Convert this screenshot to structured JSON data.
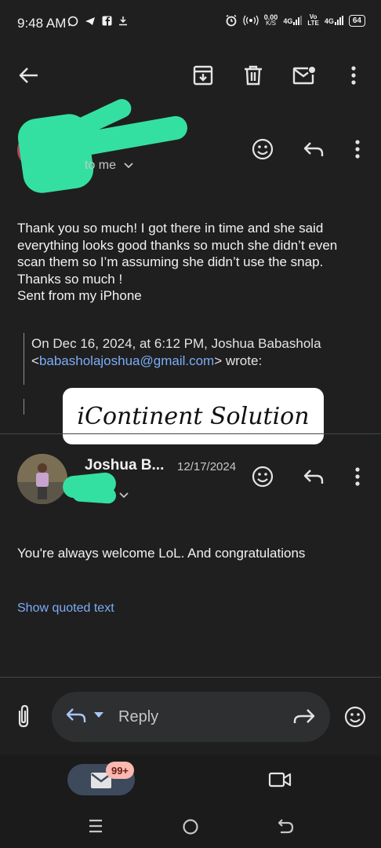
{
  "status_bar": {
    "time": "9:48 AM",
    "net_speed_value": "0.00",
    "net_speed_unit": "K/S",
    "network_1": "4G",
    "network_2_top": "Vo",
    "network_2_bottom": "LTE",
    "network_3": "4G",
    "battery": "64"
  },
  "toolbar": {
    "back_icon": "arrow-left-icon",
    "archive_icon": "archive-icon",
    "delete_icon": "trash-icon",
    "mark_unread_icon": "mail-unread-icon",
    "more_icon": "more-vertical-icon"
  },
  "message_1": {
    "to": "to me",
    "body_lines": [
      "Thank you so much! I got there in time and she said",
      "everything looks good thanks so much she didn’t even",
      "scan them so I’m assuming she didn’t use the snap.",
      "Thanks so much !",
      "Sent from my iPhone"
    ],
    "quote_line1": "On Dec 16, 2024, at 6:12 PM, Joshua Babashola",
    "quote_lt": "<",
    "quote_email": "babasholajoshua@gmail.com",
    "quote_gt_wrote": "> wrote:"
  },
  "watermark": "iContinent Solution",
  "message_2": {
    "sender": "Joshua B...",
    "date": "12/17/2024",
    "body": "You're always welcome LoL. And congratulations",
    "show_quoted": "Show quoted text"
  },
  "reply_bar": {
    "reply_label": "Reply"
  },
  "bottom_nav": {
    "mail_badge": "99+"
  },
  "colors": {
    "background": "#1f1f1f",
    "link": "#7cacf8",
    "redaction": "#34e0a1",
    "badge": "#f9b8b0"
  }
}
